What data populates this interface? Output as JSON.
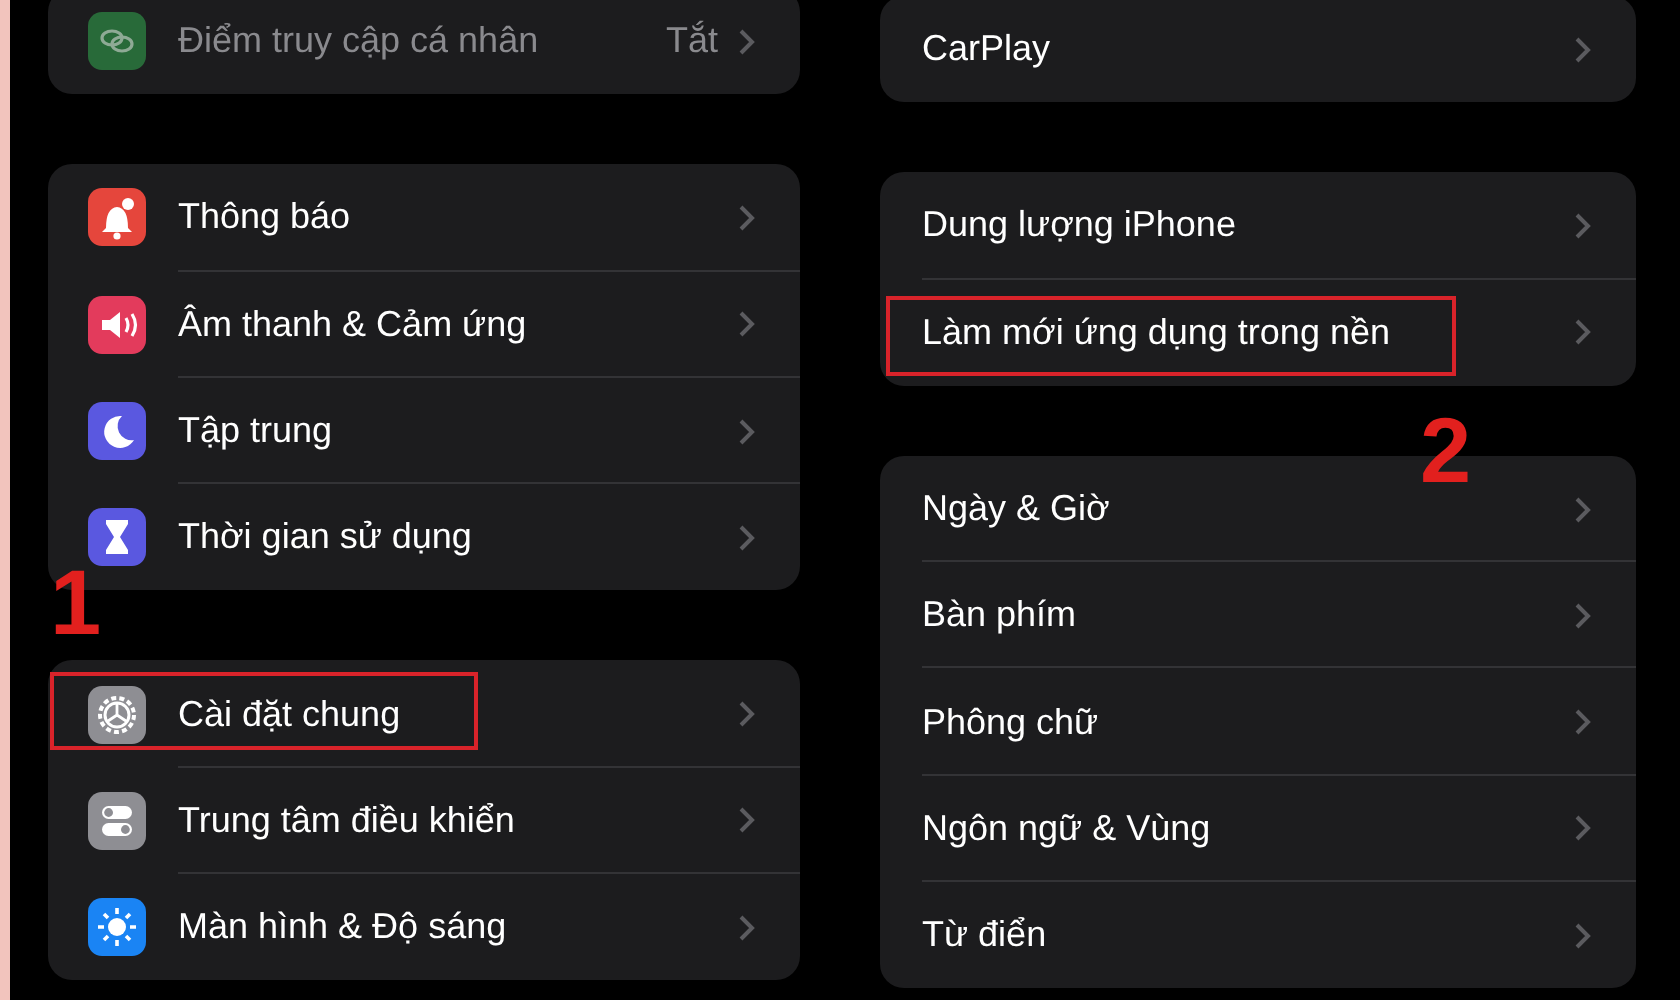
{
  "left_groups": [
    {
      "rows": [
        {
          "label": "Điểm truy cập cá nhân",
          "value": "Tắt",
          "kind": "hotspot",
          "disabled": true,
          "highlighted": false
        }
      ]
    },
    {
      "rows": [
        {
          "label": "Thông báo",
          "kind": "bell",
          "disabled": false,
          "highlighted": false
        },
        {
          "label": "Âm thanh & Cảm ứng",
          "kind": "speaker",
          "disabled": false,
          "highlighted": false
        },
        {
          "label": "Tập trung",
          "kind": "moon",
          "disabled": false,
          "highlighted": false
        },
        {
          "label": "Thời gian sử dụng",
          "kind": "hourglass",
          "disabled": false,
          "highlighted": false
        }
      ]
    },
    {
      "rows": [
        {
          "label": "Cài đặt chung",
          "kind": "gear",
          "disabled": false,
          "highlighted": true,
          "step": "1"
        },
        {
          "label": "Trung tâm điều khiển",
          "kind": "switches",
          "disabled": false,
          "highlighted": false
        },
        {
          "label": "Màn hình & Độ sáng",
          "kind": "sun",
          "disabled": false,
          "highlighted": false
        }
      ]
    }
  ],
  "right_groups": [
    {
      "rows": [
        {
          "label": "CarPlay",
          "highlighted": false
        }
      ]
    },
    {
      "rows": [
        {
          "label": "Dung lượng iPhone",
          "highlighted": false
        },
        {
          "label": "Làm mới ứng dụng trong nền",
          "highlighted": true,
          "step": "2"
        }
      ]
    },
    {
      "rows": [
        {
          "label": "Ngày & Giờ",
          "highlighted": false
        },
        {
          "label": "Bàn phím",
          "highlighted": false
        },
        {
          "label": "Phông chữ",
          "highlighted": false
        },
        {
          "label": "Ngôn ngữ & Vùng",
          "highlighted": false
        },
        {
          "label": "Từ điển",
          "highlighted": false
        }
      ]
    }
  ]
}
